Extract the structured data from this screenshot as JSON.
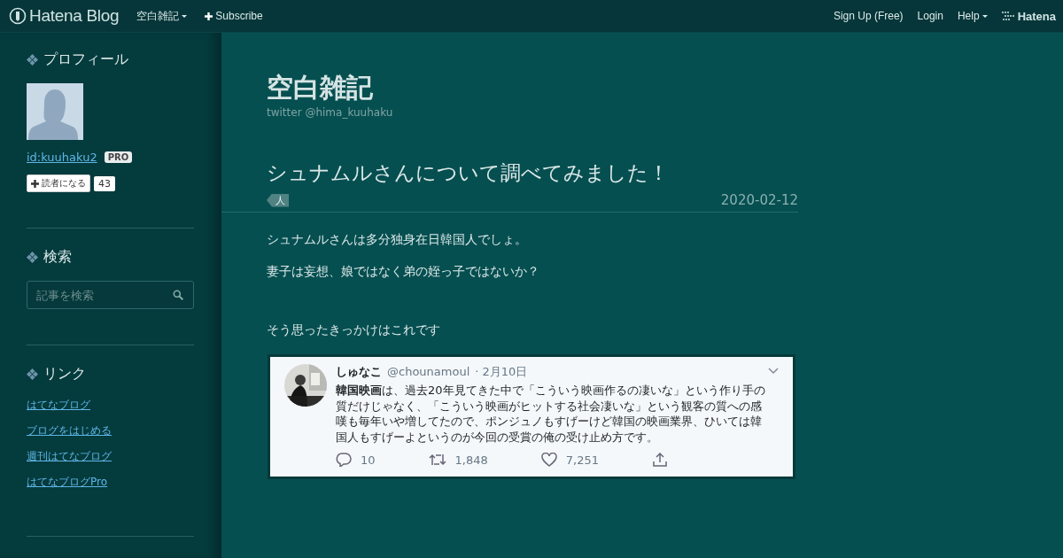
{
  "top_bar": {
    "logo": "Hatena Blog",
    "blog_menu": "空白雑記",
    "subscribe": "Subscribe",
    "right_links": [
      "Sign Up (Free)",
      "Login"
    ],
    "help": "Help",
    "brand": "Hatena"
  },
  "sidebar": {
    "profile": {
      "heading": "プロフィール",
      "user_id": "id:kuuhaku2",
      "badge": "PRO",
      "follow_button": "読者になる",
      "follower_count": "43"
    },
    "search": {
      "heading": "検索",
      "placeholder": "記事を検索"
    },
    "links": {
      "heading": "リンク",
      "items": [
        "はてなブログ",
        "ブログをはじめる",
        "週刊はてなブログ",
        "はてなブログPro"
      ]
    }
  },
  "blog": {
    "title": "空白雑記",
    "description": "twitter @hima_kuuhaku"
  },
  "article": {
    "title": "シュナムルさんについて調べてみました！",
    "category": "人",
    "date": "2020-02-12",
    "paragraphs": [
      "シュナムルさんは多分独身在日韓国人でしょ。",
      "妻子は妄想、娘ではなく弟の姪っ子ではないか？",
      "そう思ったきっかけはこれです"
    ],
    "tweet": {
      "name": "しゅなこ",
      "handle": "@chounamoul",
      "date": "· 2月10日",
      "text": "**韓国映画**は、過去20年見てきた中で「こういう映画作るの凄いな」という作り手の質だけじゃなく、「こういう映画がヒットする社会凄いな」という観客の質への感嘆も毎年いや増してたので、ポンジュノもすげーけど韓国の映画業界、ひいては韓国人もすげーよというのが今回の受賞の俺の受け止め方です。",
      "replies": "10",
      "retweets": "1,848",
      "likes": "7,251"
    }
  }
}
